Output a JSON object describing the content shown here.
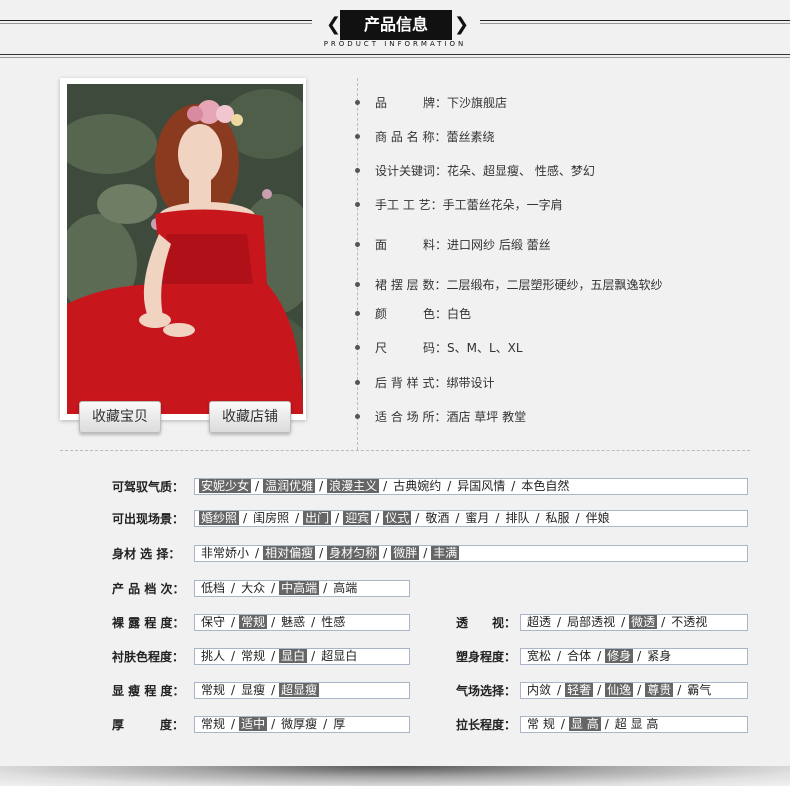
{
  "header": {
    "title": "产品信息",
    "subtitle": "PRODUCT INFORMATION"
  },
  "buttons": {
    "fav_item": "收藏宝贝",
    "fav_shop": "收藏店铺"
  },
  "info": [
    {
      "label": "品　　　牌：",
      "value": "下沙旗舰店"
    },
    {
      "label": "商 品 名 称：",
      "value": "蕾丝素绕"
    },
    {
      "label": "设计关键词：",
      "value": "花朵、超显瘦、 性感、梦幻"
    },
    {
      "label": "手工 工 艺：",
      "value": "手工蕾丝花朵，一字肩"
    },
    {
      "label": "面　　　料：",
      "value": "进口网纱 后缎 蕾丝"
    },
    {
      "label": "裙 摆 层 数：",
      "value": "二层缎布，二层塑形硬纱，五层飘逸软纱"
    },
    {
      "label": "颜　　　色：",
      "value": "白色"
    },
    {
      "label": "尺　　　码：",
      "value": "S、M、L、XL"
    },
    {
      "label": "后 背 样 式：",
      "value": "绑带设计"
    },
    {
      "label": "适 合 场 所：",
      "value": "酒店 草坪 教堂"
    }
  ],
  "props": [
    {
      "label": "可驾驭气质：",
      "options": [
        {
          "t": "安妮少女",
          "h": true
        },
        {
          "t": "温润优雅",
          "h": true
        },
        {
          "t": "浪漫主义",
          "h": true
        },
        {
          "t": "古典婉约",
          "h": false
        },
        {
          "t": "异国风情",
          "h": false
        },
        {
          "t": "本色自然",
          "h": false
        }
      ]
    },
    {
      "label": "可出现场景：",
      "options": [
        {
          "t": "婚纱照",
          "h": true
        },
        {
          "t": "闺房照",
          "h": false
        },
        {
          "t": "出门",
          "h": true
        },
        {
          "t": "迎宾",
          "h": true
        },
        {
          "t": "仪式",
          "h": true
        },
        {
          "t": "敬酒",
          "h": false
        },
        {
          "t": "蜜月",
          "h": false
        },
        {
          "t": "排队",
          "h": false
        },
        {
          "t": "私服",
          "h": false
        },
        {
          "t": "伴娘",
          "h": false
        }
      ]
    },
    {
      "label": "身材 选 择：",
      "options": [
        {
          "t": "非常娇小",
          "h": false
        },
        {
          "t": "相对偏瘦",
          "h": true
        },
        {
          "t": "身材匀称",
          "h": true
        },
        {
          "t": "微胖",
          "h": true
        },
        {
          "t": "丰满",
          "h": true
        }
      ]
    },
    {
      "label": "产 品 档 次：",
      "options": [
        {
          "t": "低档",
          "h": false
        },
        {
          "t": "大众",
          "h": false
        },
        {
          "t": "中高端",
          "h": true
        },
        {
          "t": "高端",
          "h": false
        }
      ]
    },
    {
      "label": "裸 露 程 度：",
      "options": [
        {
          "t": "保守",
          "h": false
        },
        {
          "t": "常规",
          "h": true
        },
        {
          "t": "魅惑",
          "h": false
        },
        {
          "t": "性感",
          "h": false
        }
      ]
    },
    {
      "label": "透　　视：",
      "options": [
        {
          "t": "超透",
          "h": false
        },
        {
          "t": "局部透视",
          "h": false
        },
        {
          "t": "微透",
          "h": true
        },
        {
          "t": "不透视",
          "h": false
        }
      ]
    },
    {
      "label": "衬肤色程度：",
      "options": [
        {
          "t": "挑人",
          "h": false
        },
        {
          "t": "常规",
          "h": false
        },
        {
          "t": "显白",
          "h": true
        },
        {
          "t": "超显白",
          "h": false
        }
      ]
    },
    {
      "label": "塑身程度：",
      "options": [
        {
          "t": "宽松",
          "h": false
        },
        {
          "t": "合体",
          "h": false
        },
        {
          "t": "修身",
          "h": true
        },
        {
          "t": "紧身",
          "h": false
        }
      ]
    },
    {
      "label": "显 瘦 程 度：",
      "options": [
        {
          "t": "常规",
          "h": false
        },
        {
          "t": "显瘦",
          "h": false
        },
        {
          "t": "超显瘦",
          "h": true
        }
      ]
    },
    {
      "label": "气场选择：",
      "options": [
        {
          "t": "内敛",
          "h": false
        },
        {
          "t": "轻奢",
          "h": true
        },
        {
          "t": "仙逸",
          "h": true
        },
        {
          "t": "尊贵",
          "h": true
        },
        {
          "t": "霸气",
          "h": false
        }
      ]
    },
    {
      "label": "厚　　　度：",
      "options": [
        {
          "t": "常规",
          "h": false
        },
        {
          "t": "适中",
          "h": true
        },
        {
          "t": "微厚瘦",
          "h": false
        },
        {
          "t": "厚",
          "h": false
        }
      ]
    },
    {
      "label": "拉长程度：",
      "options": [
        {
          "t": "常 规",
          "h": false
        },
        {
          "t": "显 高",
          "h": true
        },
        {
          "t": "超 显 高",
          "h": false
        }
      ]
    }
  ]
}
